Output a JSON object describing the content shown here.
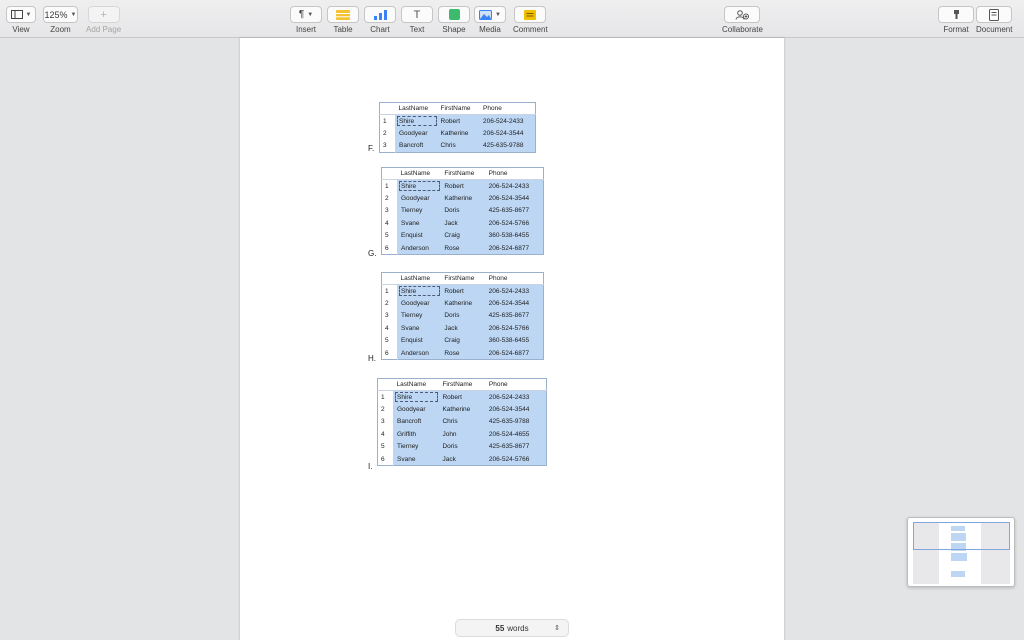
{
  "toolbar": {
    "view": {
      "label": "View",
      "icon": "sidebar-icon"
    },
    "zoom": {
      "label": "Zoom",
      "value": "125%"
    },
    "add_page": {
      "label": "Add Page",
      "icon": "plus-icon"
    },
    "insert": {
      "label": "Insert",
      "icon": "paragraph-icon",
      "glyph": "¶"
    },
    "table": {
      "label": "Table",
      "icon": "table-icon"
    },
    "chart": {
      "label": "Chart",
      "icon": "bar-chart-icon"
    },
    "text": {
      "label": "Text",
      "icon": "text-box-icon",
      "glyph": "T"
    },
    "shape": {
      "label": "Shape",
      "icon": "shape-icon"
    },
    "media": {
      "label": "Media",
      "icon": "image-icon"
    },
    "comment": {
      "label": "Comment",
      "icon": "comment-icon"
    },
    "collaborate": {
      "label": "Collaborate",
      "icon": "collaborate-icon"
    },
    "format": {
      "label": "Format",
      "icon": "paintbrush-icon"
    },
    "document": {
      "label": "Document",
      "icon": "document-icon"
    },
    "colors": {
      "table_icon": "#f5c330",
      "chart_icon": "#3b82f6",
      "shape_icon": "#3dbb6c",
      "comment_icon": "#f0c000"
    }
  },
  "options": [
    {
      "letter": "F.",
      "headers": [
        "LastName",
        "FirstName",
        "Phone"
      ],
      "rows": [
        [
          "1",
          "Shire",
          "Robert",
          "206-524-2433"
        ],
        [
          "2",
          "Goodyear",
          "Katherine",
          "206-524-3544"
        ],
        [
          "3",
          "Bancroft",
          "Chris",
          "425-635-9788"
        ]
      ]
    },
    {
      "letter": "G.",
      "headers": [
        "LastName",
        "FirstName",
        "Phone"
      ],
      "rows": [
        [
          "1",
          "Shire",
          "Robert",
          "206-524-2433"
        ],
        [
          "2",
          "Goodyear",
          "Katherine",
          "206-524-3544"
        ],
        [
          "3",
          "Tierney",
          "Doris",
          "425-635-8677"
        ],
        [
          "4",
          "Svane",
          "Jack",
          "206-524-5766"
        ],
        [
          "5",
          "Enquist",
          "Craig",
          "360-538-6455"
        ],
        [
          "6",
          "Anderson",
          "Rose",
          "206-524-6877"
        ]
      ]
    },
    {
      "letter": "H.",
      "headers": [
        "LastName",
        "FirstName",
        "Phone"
      ],
      "rows": [
        [
          "1",
          "Shire",
          "Robert",
          "206-524-2433"
        ],
        [
          "2",
          "Goodyear",
          "Katherine",
          "206-524-3544"
        ],
        [
          "3",
          "Tierney",
          "Doris",
          "425-635-8677"
        ],
        [
          "4",
          "Svane",
          "Jack",
          "206-524-5766"
        ],
        [
          "5",
          "Enquist",
          "Craig",
          "360-538-6455"
        ],
        [
          "6",
          "Anderson",
          "Rose",
          "206-524-6877"
        ]
      ]
    },
    {
      "letter": "I.",
      "headers": [
        "LastName",
        "FirstName",
        "Phone"
      ],
      "rows": [
        [
          "1",
          "Shire",
          "Robert",
          "206-524-2433"
        ],
        [
          "2",
          "Goodyear",
          "Katherine",
          "206-524-3544"
        ],
        [
          "3",
          "Bancroft",
          "Chris",
          "425-635-9788"
        ],
        [
          "4",
          "Griffith",
          "John",
          "206-524-4655"
        ],
        [
          "5",
          "Tierney",
          "Doris",
          "425-635-8677"
        ],
        [
          "6",
          "Svane",
          "Jack",
          "206-524-5766"
        ]
      ]
    }
  ],
  "status": {
    "word_count": "55",
    "word_label": "words"
  }
}
